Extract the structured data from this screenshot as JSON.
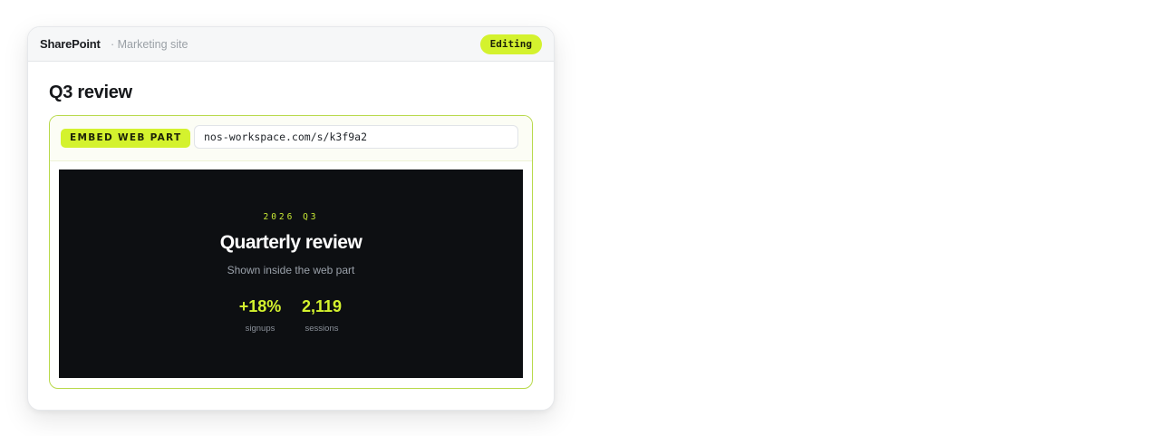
{
  "topbar": {
    "brand": "SharePoint",
    "site": "· Marketing site",
    "status_badge": "Editing"
  },
  "page": {
    "title": "Q3 review"
  },
  "webpart": {
    "tag": "EMBED WEB PART",
    "url_value": "nos-workspace.com/s/k3f9a2",
    "preview": {
      "kicker": "2026 Q3",
      "title": "Quarterly review",
      "subtitle": "Shown inside the web part",
      "stats": [
        {
          "value": "+18%",
          "label": "signups"
        },
        {
          "value": "2,119",
          "label": "sessions"
        }
      ]
    }
  },
  "colors": {
    "accent": "#d4f22e",
    "preview_bg": "#0d0f12",
    "border_accent": "#b8d94a"
  }
}
